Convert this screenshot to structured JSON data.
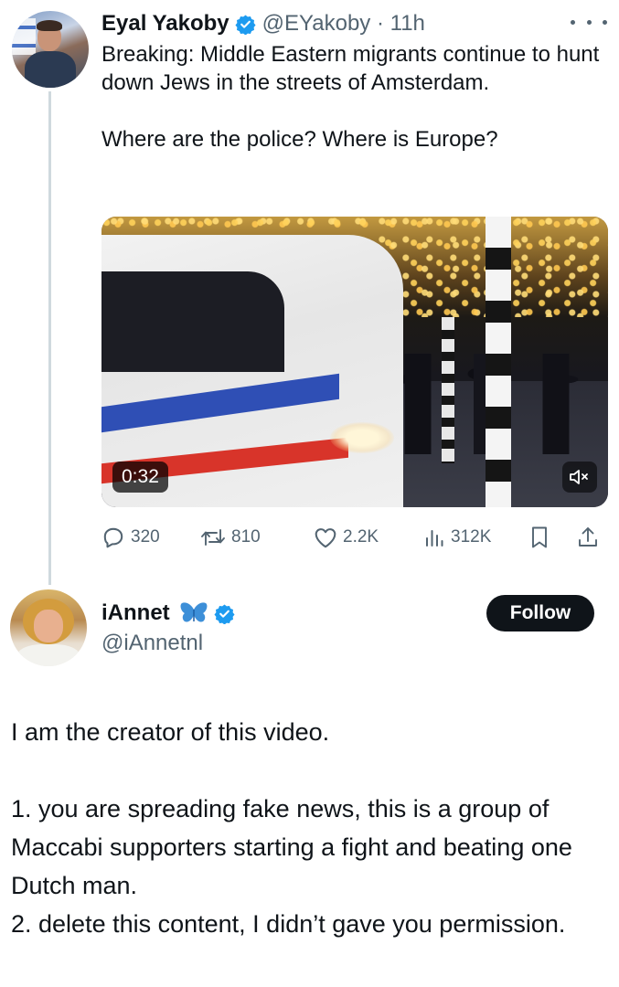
{
  "tweet": {
    "author_name": "Eyal Yakoby",
    "handle": "@EYakoby",
    "separator": " · ",
    "time": "11h",
    "text_paragraph_1": "Breaking: Middle Eastern migrants continue to hunt down Jews in the streets of Amsterdam.",
    "text_paragraph_2": "Where are the police? Where is Europe?",
    "video": {
      "duration": "0:32",
      "muted": true
    },
    "metrics": {
      "replies": "320",
      "reposts": "810",
      "likes": "2.2K",
      "views": "312K"
    }
  },
  "reply_user": {
    "name": "iAnnet",
    "handle": "@iAnnetnl",
    "follow_label": "Follow"
  },
  "reply": {
    "line_1": "I am the creator of this video.",
    "point_1": "1. you are spreading fake news, this is a group of Maccabi supporters starting a fight and beating one Dutch man.",
    "point_2": "2. delete this content, I didn’t gave you permission."
  },
  "colors": {
    "verified_blue": "#1d9bf0",
    "secondary_text": "#536471",
    "follow_button": "#0f1419",
    "thread_line": "#cfd9de"
  },
  "icons": [
    "more-icon",
    "verified-badge-icon",
    "reply-icon",
    "repost-icon",
    "like-icon",
    "views-icon",
    "bookmark-icon",
    "share-icon",
    "mute-icon",
    "butterfly-icon"
  ]
}
